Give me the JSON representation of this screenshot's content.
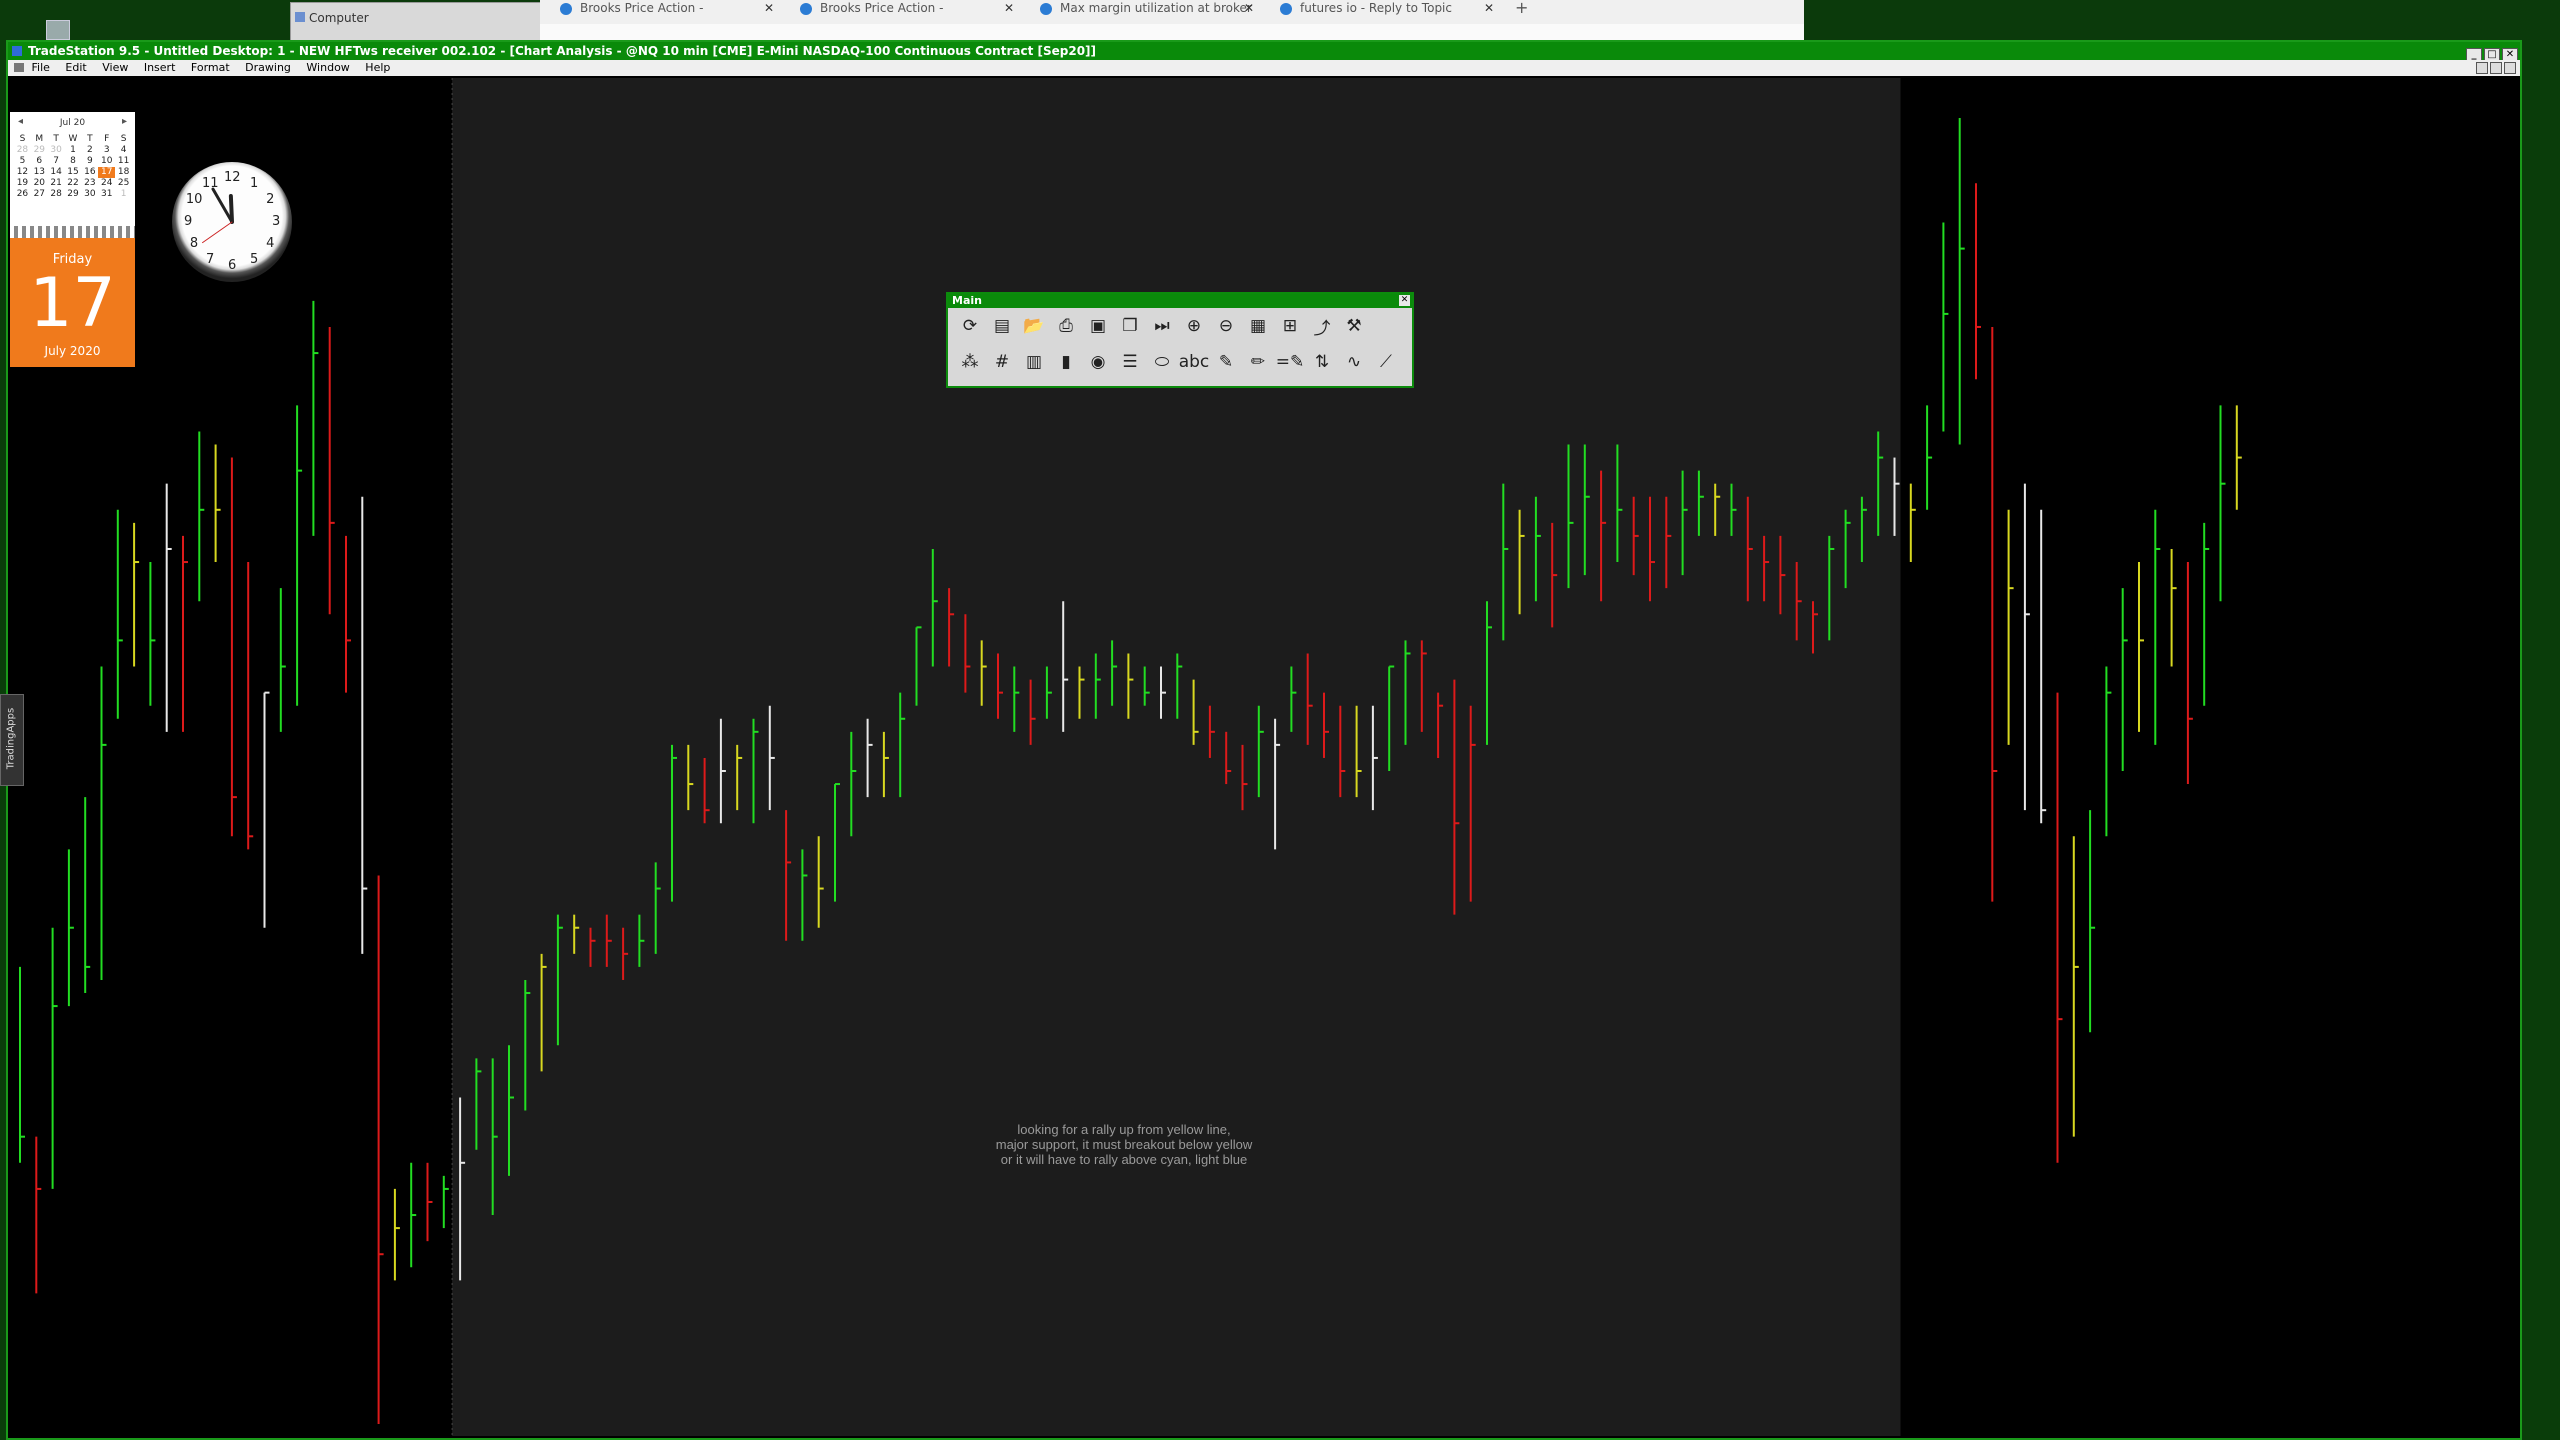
{
  "desktop": {
    "explorer_title": "Computer",
    "browser_tabs": [
      {
        "label": "Brooks Price Action -"
      },
      {
        "label": "Brooks Price Action -"
      },
      {
        "label": "Max margin utilization at broker"
      },
      {
        "label": "futures io - Reply to Topic"
      }
    ],
    "new_tab": "+"
  },
  "window": {
    "title": "TradeStation 9.5 - Untitled Desktop: 1 - NEW HFTws receiver 002.102 - [Chart Analysis - @NQ 10 min [CME] E-Mini NASDAQ-100 Continuous Contract [Sep20]]",
    "menu": [
      "File",
      "Edit",
      "View",
      "Insert",
      "Format",
      "Drawing",
      "Window",
      "Help"
    ],
    "side_tab": "TradingApps"
  },
  "calendar": {
    "month": "Jul 20",
    "weekdays": [
      "S",
      "M",
      "T",
      "W",
      "T",
      "F",
      "S"
    ],
    "weeks": [
      [
        "28",
        "29",
        "30",
        "1",
        "2",
        "3",
        "4"
      ],
      [
        "5",
        "6",
        "7",
        "8",
        "9",
        "10",
        "11"
      ],
      [
        "12",
        "13",
        "14",
        "15",
        "16",
        "17",
        "18"
      ],
      [
        "19",
        "20",
        "21",
        "22",
        "23",
        "24",
        "25"
      ],
      [
        "26",
        "27",
        "28",
        "29",
        "30",
        "31",
        "1"
      ]
    ],
    "today": "17",
    "day_name": "Friday",
    "day_number": "17",
    "month_year": "July 2020"
  },
  "clock": {
    "numbers": [
      "12",
      "1",
      "2",
      "3",
      "4",
      "5",
      "6",
      "7",
      "8",
      "9",
      "10",
      "11"
    ],
    "time": "11:55"
  },
  "toolbar": {
    "title": "Main",
    "row1": [
      {
        "name": "refresh-icon",
        "g": "⟳"
      },
      {
        "name": "chart-window-icon",
        "g": "▤"
      },
      {
        "name": "open-folder-icon",
        "g": "📂"
      },
      {
        "name": "print-icon",
        "g": "⎙"
      },
      {
        "name": "save-icon",
        "g": "▣"
      },
      {
        "name": "copy-icon",
        "g": "❐"
      },
      {
        "name": "play-next-icon",
        "g": "⏭"
      },
      {
        "name": "zoom-in-icon",
        "g": "⊕"
      },
      {
        "name": "zoom-out-icon",
        "g": "⊖"
      },
      {
        "name": "color-palette-icon",
        "g": "▦"
      },
      {
        "name": "grid-icon",
        "g": "⊞"
      },
      {
        "name": "curve-icon",
        "g": "⤴"
      },
      {
        "name": "tools-icon",
        "g": "⚒"
      }
    ],
    "row2": [
      {
        "name": "indicator-icon",
        "g": "⁂"
      },
      {
        "name": "hash-icon",
        "g": "#"
      },
      {
        "name": "layout-icon",
        "g": "▥"
      },
      {
        "name": "signal-icon",
        "g": "▮"
      },
      {
        "name": "camera-icon",
        "g": "◉"
      },
      {
        "name": "list-icon",
        "g": "☰"
      },
      {
        "name": "ellipse-icon",
        "g": "⬭"
      },
      {
        "name": "text-tool-icon",
        "g": "abc"
      },
      {
        "name": "highlighter-icon",
        "g": "✎"
      },
      {
        "name": "pencil-icon",
        "g": "✏"
      },
      {
        "name": "equals-icon",
        "g": "=✎"
      },
      {
        "name": "ruler-icon",
        "g": "⇅"
      },
      {
        "name": "wave-icon",
        "g": "∿"
      },
      {
        "name": "trendline-icon",
        "g": "⟋"
      }
    ]
  },
  "annotation": {
    "lines": [
      "looking for a rally up from yellow line,",
      "major support, it must breakout below yellow",
      "or it will have to rally above cyan, light blue"
    ]
  },
  "colors": {
    "up": "#22dd22",
    "down": "#dd1a1a",
    "neutral_yellow": "#d8d820",
    "white_bar": "#e8e8e8",
    "session_bg": "#1c1c1c",
    "accent": "#0a8a0a"
  },
  "chart_data": {
    "type": "ohlc",
    "symbol": "@NQ",
    "interval": "10 min",
    "title": "",
    "xlabel": "",
    "ylabel": "",
    "price_range": [
      0,
      100
    ],
    "session_shading": {
      "start_index": 27,
      "end_index": 115
    },
    "bars": [
      {
        "c": "g",
        "h": 35,
        "l": 20,
        "cl": 22
      },
      {
        "c": "r",
        "h": 22,
        "l": 10,
        "cl": 18
      },
      {
        "c": "g",
        "h": 38,
        "l": 18,
        "cl": 32
      },
      {
        "c": "g",
        "h": 44,
        "l": 32,
        "cl": 38
      },
      {
        "c": "g",
        "h": 48,
        "l": 33,
        "cl": 35
      },
      {
        "c": "g",
        "h": 58,
        "l": 34,
        "cl": 52
      },
      {
        "c": "g",
        "h": 70,
        "l": 54,
        "cl": 60
      },
      {
        "c": "y",
        "h": 69,
        "l": 58,
        "cl": 66
      },
      {
        "c": "g",
        "h": 66,
        "l": 55,
        "cl": 60
      },
      {
        "c": "w",
        "h": 72,
        "l": 53,
        "cl": 67
      },
      {
        "c": "r",
        "h": 68,
        "l": 53,
        "cl": 66
      },
      {
        "c": "g",
        "h": 76,
        "l": 63,
        "cl": 70
      },
      {
        "c": "y",
        "h": 75,
        "l": 66,
        "cl": 70
      },
      {
        "c": "r",
        "h": 74,
        "l": 45,
        "cl": 48
      },
      {
        "c": "r",
        "h": 66,
        "l": 44,
        "cl": 45
      },
      {
        "c": "w",
        "h": 56,
        "l": 38,
        "cl": 56
      },
      {
        "c": "g",
        "h": 64,
        "l": 53,
        "cl": 58
      },
      {
        "c": "g",
        "h": 78,
        "l": 55,
        "cl": 73
      },
      {
        "c": "g",
        "h": 86,
        "l": 68,
        "cl": 82
      },
      {
        "c": "r",
        "h": 84,
        "l": 62,
        "cl": 69
      },
      {
        "c": "r",
        "h": 68,
        "l": 56,
        "cl": 60
      },
      {
        "c": "w",
        "h": 71,
        "l": 36,
        "cl": 41
      },
      {
        "c": "r",
        "h": 42,
        "l": 0,
        "cl": 13
      },
      {
        "c": "y",
        "h": 18,
        "l": 11,
        "cl": 15
      },
      {
        "c": "g",
        "h": 20,
        "l": 12,
        "cl": 16
      },
      {
        "c": "r",
        "h": 20,
        "l": 14,
        "cl": 17
      },
      {
        "c": "g",
        "h": 19,
        "l": 15,
        "cl": 18
      },
      {
        "c": "w",
        "h": 25,
        "l": 11,
        "cl": 20
      },
      {
        "c": "g",
        "h": 28,
        "l": 21,
        "cl": 27
      },
      {
        "c": "g",
        "h": 28,
        "l": 16,
        "cl": 22
      },
      {
        "c": "g",
        "h": 29,
        "l": 19,
        "cl": 25
      },
      {
        "c": "g",
        "h": 34,
        "l": 24,
        "cl": 33
      },
      {
        "c": "y",
        "h": 36,
        "l": 27,
        "cl": 35
      },
      {
        "c": "g",
        "h": 39,
        "l": 29,
        "cl": 38
      },
      {
        "c": "y",
        "h": 39,
        "l": 36,
        "cl": 38
      },
      {
        "c": "r",
        "h": 38,
        "l": 35,
        "cl": 37
      },
      {
        "c": "r",
        "h": 39,
        "l": 35,
        "cl": 37
      },
      {
        "c": "r",
        "h": 38,
        "l": 34,
        "cl": 36
      },
      {
        "c": "g",
        "h": 39,
        "l": 35,
        "cl": 37
      },
      {
        "c": "g",
        "h": 43,
        "l": 36,
        "cl": 41
      },
      {
        "c": "g",
        "h": 52,
        "l": 40,
        "cl": 51
      },
      {
        "c": "y",
        "h": 52,
        "l": 47,
        "cl": 49
      },
      {
        "c": "r",
        "h": 51,
        "l": 46,
        "cl": 47
      },
      {
        "c": "w",
        "h": 54,
        "l": 46,
        "cl": 50
      },
      {
        "c": "y",
        "h": 52,
        "l": 47,
        "cl": 51
      },
      {
        "c": "g",
        "h": 54,
        "l": 46,
        "cl": 53
      },
      {
        "c": "w",
        "h": 55,
        "l": 47,
        "cl": 51
      },
      {
        "c": "r",
        "h": 47,
        "l": 37,
        "cl": 43
      },
      {
        "c": "g",
        "h": 44,
        "l": 37,
        "cl": 42
      },
      {
        "c": "y",
        "h": 45,
        "l": 38,
        "cl": 41
      },
      {
        "c": "g",
        "h": 49,
        "l": 40,
        "cl": 49
      },
      {
        "c": "g",
        "h": 53,
        "l": 45,
        "cl": 50
      },
      {
        "c": "w",
        "h": 54,
        "l": 48,
        "cl": 52
      },
      {
        "c": "y",
        "h": 53,
        "l": 48,
        "cl": 51
      },
      {
        "c": "g",
        "h": 56,
        "l": 48,
        "cl": 54
      },
      {
        "c": "g",
        "h": 61,
        "l": 55,
        "cl": 61
      },
      {
        "c": "g",
        "h": 67,
        "l": 58,
        "cl": 63
      },
      {
        "c": "r",
        "h": 64,
        "l": 58,
        "cl": 62
      },
      {
        "c": "r",
        "h": 62,
        "l": 56,
        "cl": 58
      },
      {
        "c": "y",
        "h": 60,
        "l": 55,
        "cl": 58
      },
      {
        "c": "r",
        "h": 59,
        "l": 54,
        "cl": 56
      },
      {
        "c": "g",
        "h": 58,
        "l": 53,
        "cl": 56
      },
      {
        "c": "r",
        "h": 57,
        "l": 52,
        "cl": 54
      },
      {
        "c": "g",
        "h": 58,
        "l": 54,
        "cl": 56
      },
      {
        "c": "w",
        "h": 63,
        "l": 53,
        "cl": 57
      },
      {
        "c": "y",
        "h": 58,
        "l": 54,
        "cl": 57
      },
      {
        "c": "g",
        "h": 59,
        "l": 54,
        "cl": 57
      },
      {
        "c": "g",
        "h": 60,
        "l": 55,
        "cl": 58
      },
      {
        "c": "y",
        "h": 59,
        "l": 54,
        "cl": 57
      },
      {
        "c": "g",
        "h": 58,
        "l": 55,
        "cl": 56
      },
      {
        "c": "w",
        "h": 58,
        "l": 54,
        "cl": 56
      },
      {
        "c": "g",
        "h": 59,
        "l": 54,
        "cl": 58
      },
      {
        "c": "y",
        "h": 57,
        "l": 52,
        "cl": 53
      },
      {
        "c": "r",
        "h": 55,
        "l": 51,
        "cl": 53
      },
      {
        "c": "r",
        "h": 53,
        "l": 49,
        "cl": 50
      },
      {
        "c": "r",
        "h": 52,
        "l": 47,
        "cl": 49
      },
      {
        "c": "g",
        "h": 55,
        "l": 48,
        "cl": 53
      },
      {
        "c": "w",
        "h": 54,
        "l": 44,
        "cl": 52
      },
      {
        "c": "g",
        "h": 58,
        "l": 53,
        "cl": 56
      },
      {
        "c": "r",
        "h": 59,
        "l": 52,
        "cl": 55
      },
      {
        "c": "r",
        "h": 56,
        "l": 51,
        "cl": 53
      },
      {
        "c": "r",
        "h": 55,
        "l": 48,
        "cl": 50
      },
      {
        "c": "y",
        "h": 55,
        "l": 48,
        "cl": 50
      },
      {
        "c": "w",
        "h": 55,
        "l": 47,
        "cl": 51
      },
      {
        "c": "g",
        "h": 58,
        "l": 50,
        "cl": 58
      },
      {
        "c": "g",
        "h": 60,
        "l": 52,
        "cl": 59
      },
      {
        "c": "r",
        "h": 60,
        "l": 53,
        "cl": 59
      },
      {
        "c": "r",
        "h": 56,
        "l": 51,
        "cl": 55
      },
      {
        "c": "r",
        "h": 57,
        "l": 39,
        "cl": 46
      },
      {
        "c": "r",
        "h": 55,
        "l": 40,
        "cl": 52
      },
      {
        "c": "g",
        "h": 63,
        "l": 52,
        "cl": 61
      },
      {
        "c": "g",
        "h": 72,
        "l": 60,
        "cl": 67
      },
      {
        "c": "y",
        "h": 70,
        "l": 62,
        "cl": 68
      },
      {
        "c": "g",
        "h": 71,
        "l": 63,
        "cl": 68
      },
      {
        "c": "r",
        "h": 69,
        "l": 61,
        "cl": 65
      },
      {
        "c": "g",
        "h": 75,
        "l": 64,
        "cl": 69
      },
      {
        "c": "g",
        "h": 75,
        "l": 65,
        "cl": 71
      },
      {
        "c": "r",
        "h": 73,
        "l": 63,
        "cl": 69
      },
      {
        "c": "g",
        "h": 75,
        "l": 66,
        "cl": 70
      },
      {
        "c": "r",
        "h": 71,
        "l": 65,
        "cl": 68
      },
      {
        "c": "r",
        "h": 71,
        "l": 63,
        "cl": 66
      },
      {
        "c": "r",
        "h": 71,
        "l": 64,
        "cl": 68
      },
      {
        "c": "g",
        "h": 73,
        "l": 65,
        "cl": 70
      },
      {
        "c": "g",
        "h": 73,
        "l": 68,
        "cl": 71
      },
      {
        "c": "y",
        "h": 72,
        "l": 68,
        "cl": 71
      },
      {
        "c": "g",
        "h": 72,
        "l": 68,
        "cl": 70
      },
      {
        "c": "r",
        "h": 71,
        "l": 63,
        "cl": 67
      },
      {
        "c": "r",
        "h": 68,
        "l": 63,
        "cl": 66
      },
      {
        "c": "r",
        "h": 68,
        "l": 62,
        "cl": 65
      },
      {
        "c": "r",
        "h": 66,
        "l": 60,
        "cl": 63
      },
      {
        "c": "r",
        "h": 63,
        "l": 59,
        "cl": 62
      },
      {
        "c": "g",
        "h": 68,
        "l": 60,
        "cl": 67
      },
      {
        "c": "g",
        "h": 70,
        "l": 64,
        "cl": 69
      },
      {
        "c": "g",
        "h": 71,
        "l": 66,
        "cl": 70
      },
      {
        "c": "g",
        "h": 76,
        "l": 68,
        "cl": 74
      },
      {
        "c": "w",
        "h": 74,
        "l": 68,
        "cl": 72
      },
      {
        "c": "y",
        "h": 72,
        "l": 66,
        "cl": 70
      },
      {
        "c": "g",
        "h": 78,
        "l": 70,
        "cl": 74
      },
      {
        "c": "g",
        "h": 92,
        "l": 76,
        "cl": 85
      },
      {
        "c": "g",
        "h": 100,
        "l": 75,
        "cl": 90
      },
      {
        "c": "r",
        "h": 95,
        "l": 80,
        "cl": 84
      },
      {
        "c": "r",
        "h": 84,
        "l": 40,
        "cl": 50
      },
      {
        "c": "y",
        "h": 70,
        "l": 52,
        "cl": 64
      },
      {
        "c": "w",
        "h": 72,
        "l": 47,
        "cl": 62
      },
      {
        "c": "w",
        "h": 70,
        "l": 46,
        "cl": 47
      },
      {
        "c": "r",
        "h": 56,
        "l": 20,
        "cl": 31
      },
      {
        "c": "y",
        "h": 45,
        "l": 22,
        "cl": 35
      },
      {
        "c": "g",
        "h": 47,
        "l": 30,
        "cl": 38
      },
      {
        "c": "g",
        "h": 58,
        "l": 45,
        "cl": 56
      },
      {
        "c": "g",
        "h": 64,
        "l": 50,
        "cl": 60
      },
      {
        "c": "y",
        "h": 66,
        "l": 53,
        "cl": 60
      },
      {
        "c": "g",
        "h": 70,
        "l": 52,
        "cl": 67
      },
      {
        "c": "y",
        "h": 67,
        "l": 58,
        "cl": 64
      },
      {
        "c": "r",
        "h": 66,
        "l": 49,
        "cl": 54
      },
      {
        "c": "g",
        "h": 69,
        "l": 55,
        "cl": 67
      },
      {
        "c": "g",
        "h": 78,
        "l": 63,
        "cl": 72
      },
      {
        "c": "y",
        "h": 78,
        "l": 70,
        "cl": 74
      }
    ]
  }
}
